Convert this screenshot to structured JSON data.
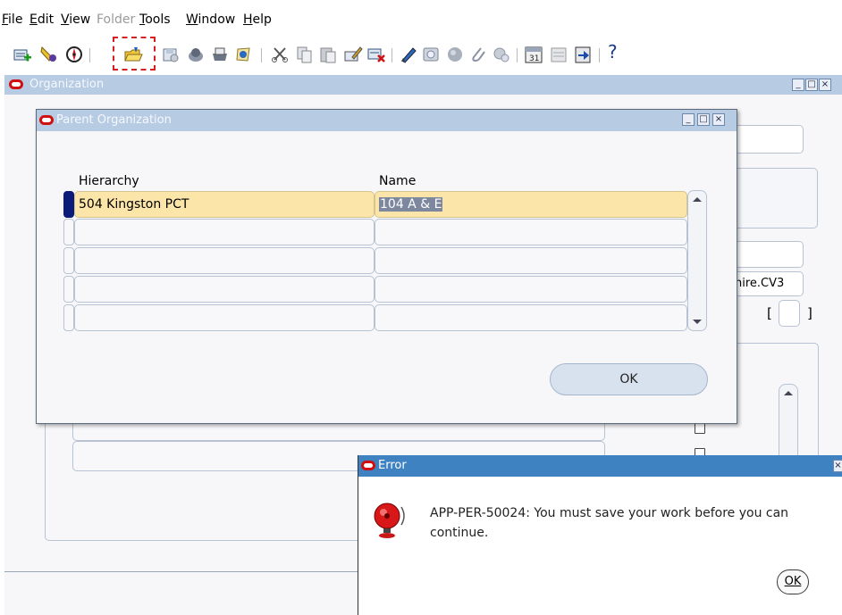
{
  "menubar": {
    "items": [
      {
        "label": "File",
        "mnemonic": "F",
        "rest": "ile",
        "enabled": true
      },
      {
        "label": "Edit",
        "mnemonic": "E",
        "rest": "dit",
        "enabled": true
      },
      {
        "label": "View",
        "mnemonic": "V",
        "rest": "iew",
        "enabled": true
      },
      {
        "label": "Folder",
        "mnemonic": "",
        "rest": "Folder",
        "enabled": false
      },
      {
        "label": "Tools",
        "mnemonic": "T",
        "rest": "ools",
        "enabled": true
      },
      {
        "label": "Window",
        "mnemonic": "W",
        "rest": "indow",
        "enabled": true
      },
      {
        "label": "Help",
        "mnemonic": "H",
        "rest": "elp",
        "enabled": true
      }
    ]
  },
  "toolbar": {
    "icons": [
      "new-record-icon",
      "find-icon",
      "navigator-icon",
      "open-folder-icon",
      "save-icon",
      "print-icon",
      "close-form-icon",
      "new-icon",
      "cut-icon",
      "copy-icon",
      "paste-icon",
      "clear-record-icon",
      "delete-record-icon",
      "edit-field-icon",
      "zoom-icon",
      "translations-icon",
      "attachments-icon",
      "folder-tools-icon",
      "calendar-icon",
      "clear-icon",
      "switch-responsibility-icon",
      "help-icon"
    ],
    "help_glyph": "?"
  },
  "org_window": {
    "title": "Organization",
    "bg_field_text": "hire.CV3",
    "bracket_left": "[",
    "bracket_right": "]"
  },
  "parent_dialog": {
    "title": "Parent Organization",
    "columns": {
      "hierarchy": "Hierarchy",
      "name": "Name"
    },
    "rows": [
      {
        "hierarchy": "504 Kingston PCT",
        "name": "104 A & E"
      },
      {
        "hierarchy": "",
        "name": ""
      },
      {
        "hierarchy": "",
        "name": ""
      },
      {
        "hierarchy": "",
        "name": ""
      },
      {
        "hierarchy": "",
        "name": ""
      }
    ],
    "ok_label": "OK"
  },
  "error_dialog": {
    "title": "Error",
    "message": "APP-PER-50024: You must save your work before you can continue.",
    "ok_label": "OK"
  },
  "colors": {
    "title_inactive": "#b7cbe2",
    "title_active": "#3e82c1",
    "current_field": "#fce5a8",
    "highlight_box": "#d42020"
  }
}
